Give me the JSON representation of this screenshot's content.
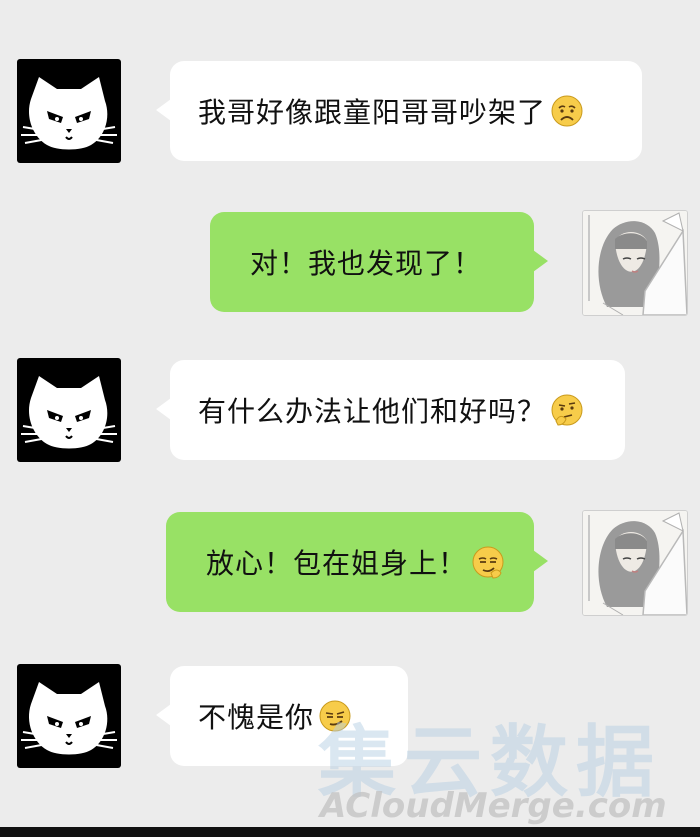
{
  "chat": {
    "messages": [
      {
        "sender": "cat",
        "text": "我哥好像跟童阳哥哥吵架了",
        "emoji": "worried-face"
      },
      {
        "sender": "girl",
        "text": "对！我也发现了！",
        "emoji": ""
      },
      {
        "sender": "cat",
        "text": "有什么办法让他们和好吗？",
        "emoji": "thinking-face"
      },
      {
        "sender": "girl",
        "text": "放心！包在姐身上！",
        "emoji": "smug-face"
      },
      {
        "sender": "cat",
        "text": "不愧是你",
        "emoji": "smirk-face"
      }
    ]
  },
  "colors": {
    "background": "#ececec",
    "incoming_bubble": "#ffffff",
    "outgoing_bubble": "#98e165",
    "cat_avatar_bg": "#000000"
  },
  "watermark": {
    "chinese": "集云数据",
    "english": "ACloudMerge.com"
  }
}
